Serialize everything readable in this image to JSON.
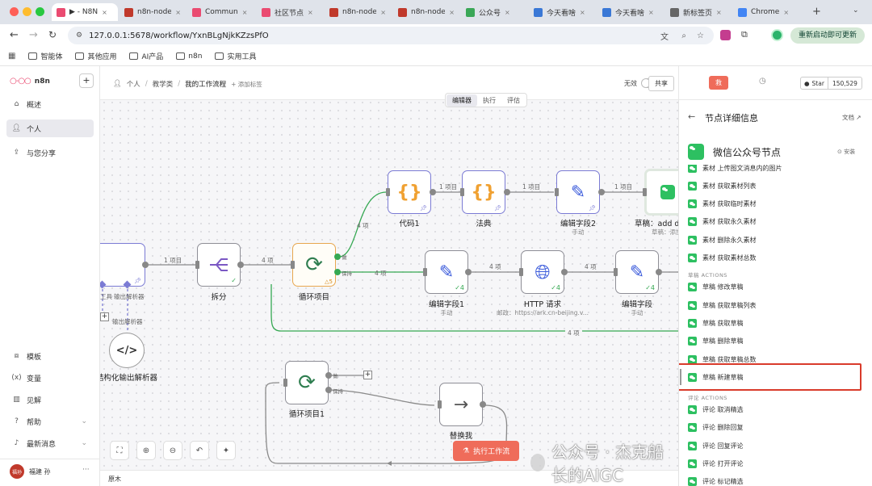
{
  "browser": {
    "tabs": [
      {
        "label": "▶ - N8N",
        "fav": "n8n-icon",
        "color": "#ea4b71"
      },
      {
        "label": "n8n-node",
        "fav": "n-icon",
        "color": "#c0392b"
      },
      {
        "label": "Commun",
        "fav": "n8n-icon",
        "color": "#ea4b71"
      },
      {
        "label": "社区节点",
        "fav": "n8n-icon",
        "color": "#ea4b71"
      },
      {
        "label": "n8n-node",
        "fav": "n-icon",
        "color": "#c0392b"
      },
      {
        "label": "n8n-node",
        "fav": "n-icon",
        "color": "#c0392b"
      },
      {
        "label": "公众号",
        "fav": "recycle-icon",
        "color": "#3aa757"
      },
      {
        "label": "今天看啥",
        "fav": "book-icon",
        "color": "#3a78d6"
      },
      {
        "label": "今天看啥",
        "fav": "book-icon",
        "color": "#3a78d6"
      },
      {
        "label": "新标签页",
        "fav": "chrome-icon",
        "color": "#666"
      },
      {
        "label": "Chrome",
        "fav": "chrome-icon",
        "color": "#4285f4"
      }
    ],
    "url": "127.0.0.1:5678/workflow/YxnBLgNjkKZzsPfO",
    "restart_label": "重新启动即可更新",
    "bookmarks": [
      "智能体",
      "其他应用",
      "AI产品",
      "n8n",
      "实用工具"
    ]
  },
  "sidebar": {
    "brand": "n8n",
    "items": [
      "概述",
      "个人",
      "与您分享"
    ],
    "bottom": [
      "模板",
      "变量",
      "见解",
      "帮助",
      "最新消息"
    ],
    "user": "福建 孙",
    "avatar": "福孙"
  },
  "header": {
    "crumb_1": "个人",
    "crumb_2": "教学类",
    "crumb_3": "我的工作流程",
    "add_tag": "+ 添加标签",
    "inactive": "无效",
    "share": "共享",
    "save": "救",
    "github_star": "Star",
    "stars": "150,529"
  },
  "modes": [
    "编辑器",
    "执行",
    "评估"
  ],
  "nodes": {
    "code1": "代码1",
    "fadian": "法典",
    "edit2": "编辑字段2",
    "edit2_sub": "手动",
    "draft": "草稿：add d",
    "draft_sub": "草稿：添加",
    "split": "拆分",
    "loop": "循环项目",
    "loop_warn": "△5",
    "edit1": "编辑字段1",
    "edit1_sub": "手动",
    "http": "HTTP 请求",
    "http_sub": "邮政：https://ark.cn-beijing.v...",
    "edit3": "编辑字段",
    "edit3_sub": "手动",
    "struct": "结构化输出解析器",
    "loop1": "循环项目1",
    "replace": "替换我",
    "left_tool": "工具",
    "left_parser": "输出解析器",
    "left_parser2": "输出解析器"
  },
  "edges": {
    "e1": "1 项目",
    "e2": "4 项",
    "e3": "4 项",
    "e4": "1 项目",
    "e5": "1 项目",
    "e6": "1 项目",
    "e7": "4 项",
    "e8": "4 项",
    "e9": "4 项",
    "e10": "4 项",
    "done": "做",
    "loop_lbl": "保持",
    "done2": "做",
    "loop2": "保持"
  },
  "run_button": "执行工作流",
  "log_label": "原木",
  "panel": {
    "title": "节点详细信息",
    "docs": "文档",
    "node_title": "微信公众号节点",
    "install": "安装",
    "items_top": [
      "素材 上传图文消息内的图片",
      "素材 获取素材列表",
      "素材 获取临时素材",
      "素材 获取永久素材",
      "素材 删除永久素材",
      "素材 获取素材总数"
    ],
    "draft_section": "草稿 ACTIONS",
    "draft_items": [
      "草稿 修改草稿",
      "草稿 获取草稿列表",
      "草稿 获取草稿",
      "草稿 删除草稿",
      "草稿 获取草稿总数",
      "草稿 新建草稿"
    ],
    "comment_section": "评论 ACTIONS",
    "comment_items": [
      "评论 取消精选",
      "评论 删除回复",
      "评论 回复评论",
      "评论 打开评论",
      "评论 标记精选"
    ]
  },
  "watermark": "公众号 · 杰克船长的AIGC"
}
